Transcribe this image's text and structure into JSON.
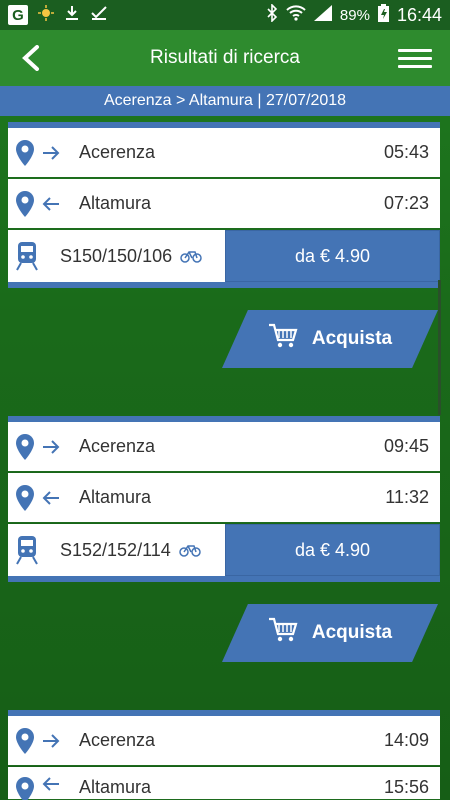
{
  "status_bar": {
    "g_label": "G",
    "battery": "89%",
    "time": "16:44",
    "icons": [
      "weather-icon",
      "download-icon",
      "check-icon",
      "bluetooth-icon",
      "wifi-icon",
      "signal-icon",
      "battery-icon"
    ]
  },
  "appbar": {
    "title": "Risultati di ricerca"
  },
  "route": {
    "text": "Acerenza > Altamura | 27/07/2018"
  },
  "colors": {
    "green_dark": "#1b5e20",
    "green_appbar": "#2e8b2e",
    "blue_accent": "#4474b5"
  },
  "results": [
    {
      "departure": {
        "station": "Acerenza",
        "time": "05:43"
      },
      "arrival": {
        "station": "Altamura",
        "time": "07:23"
      },
      "train_code": "S150/150/106",
      "price": "da € 4.90",
      "buy_label": "Acquista"
    },
    {
      "departure": {
        "station": "Acerenza",
        "time": "09:45"
      },
      "arrival": {
        "station": "Altamura",
        "time": "11:32"
      },
      "train_code": "S152/152/114",
      "price": "da € 4.90",
      "buy_label": "Acquista"
    },
    {
      "departure": {
        "station": "Acerenza",
        "time": "14:09"
      },
      "arrival": {
        "station": "Altamura",
        "time": "15:56"
      }
    }
  ]
}
